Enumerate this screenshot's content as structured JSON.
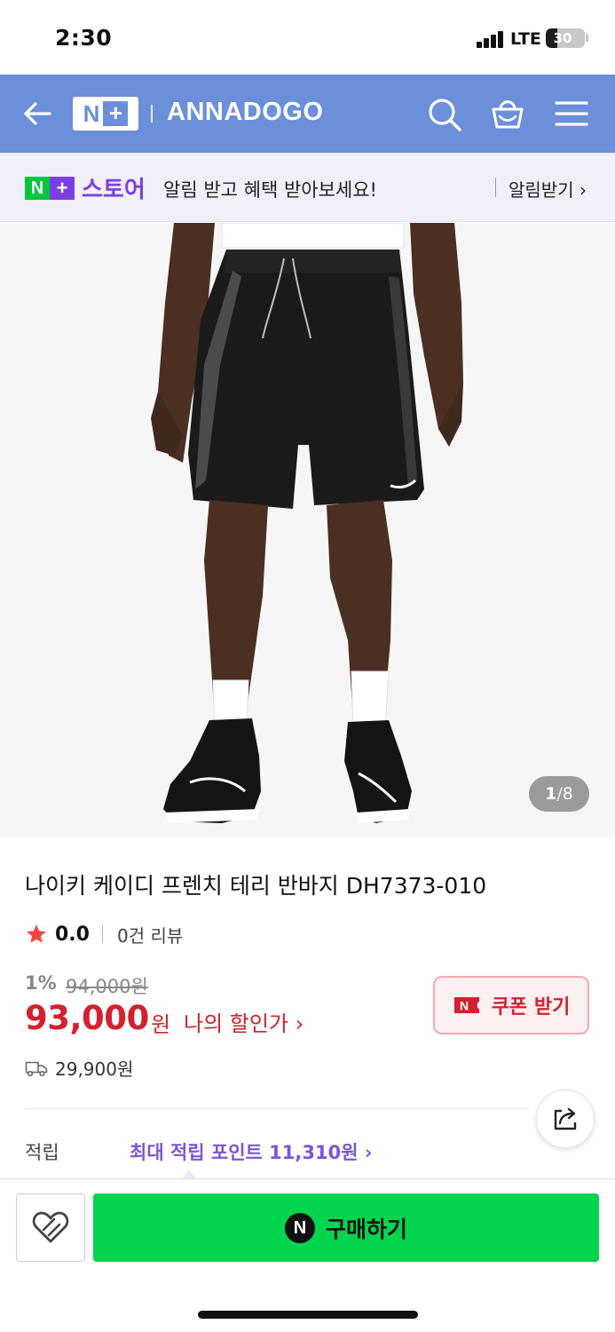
{
  "status": {
    "time": "2:30",
    "network": "LTE",
    "battery": "30",
    "battery_level": 0.3
  },
  "nav": {
    "brand_logo_n": "N",
    "brand_logo_plus": "+",
    "brand_name": "ANNADOGO"
  },
  "promo": {
    "logo_n": "N",
    "logo_plus": "+",
    "store_label": "스토어",
    "message": "알림 받고 혜택 받아보세요!",
    "button": "알림받기 ›"
  },
  "image": {
    "current": "1",
    "separator": "/",
    "total": "8"
  },
  "product": {
    "title": "나이키 케이디 프렌치 테리 반바지 DH7373-010",
    "rating": "0.0",
    "review_count": "0건 리뷰",
    "discount_rate": "1%",
    "original_price": "94,000원",
    "sale_price": "93,000",
    "currency": "원",
    "my_price_link": "나의 할인가 ›",
    "coupon_label": "쿠폰 받기",
    "delivery_fee": "29,900원",
    "points_label": "적립",
    "points_value": "최대 적립 포인트 11,310원 ›"
  },
  "bottom": {
    "npay_icon": "N",
    "buy_label": "구매하기"
  },
  "colors": {
    "nav_bg": "#6b8fd9",
    "price_red": "#d4202f",
    "buy_green": "#03d44e",
    "naver_green": "#00c73c",
    "store_purple": "#7b3fe4",
    "points_purple": "#7a55d6"
  }
}
